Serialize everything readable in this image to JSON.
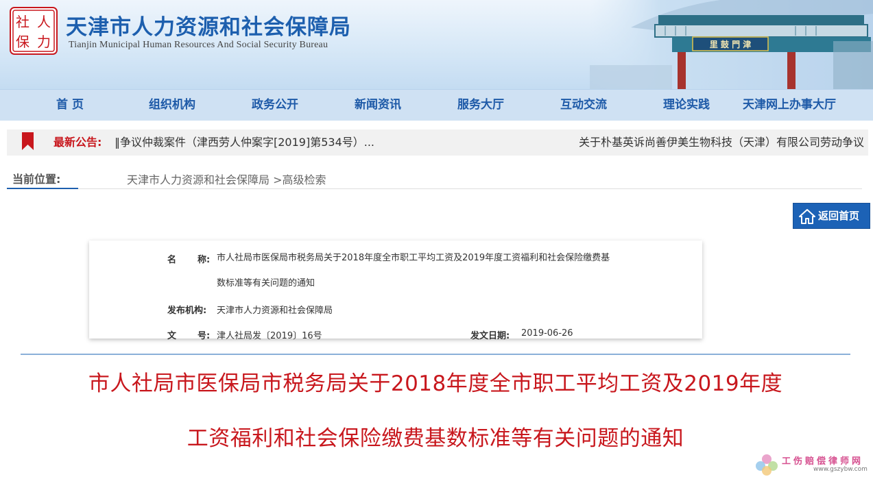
{
  "header": {
    "logo_chars": "社人保力",
    "title": "天津市人力资源和社会保障局",
    "subtitle": "Tianjin Municipal Human Resources And Social Security Bureau",
    "gate_sign": "里鼓门津"
  },
  "nav": {
    "items": [
      {
        "label": "首 页"
      },
      {
        "label": "组织机构"
      },
      {
        "label": "政务公开"
      },
      {
        "label": "新闻资讯"
      },
      {
        "label": "服务大厅"
      },
      {
        "label": "互动交流"
      },
      {
        "label": "理论实践"
      },
      {
        "label": "天津网上办事大厅"
      }
    ]
  },
  "notice": {
    "label": "最新公告:",
    "text1": "‖争议仲裁案件（津西劳人仲案字[2019]第534号）...",
    "text2": "关于朴基英诉尚善伊美生物科技（天津）有限公司劳动争议"
  },
  "breadcrumb": {
    "label": "当前位置:",
    "home": "天津市人力资源和社会保障局",
    "current": ">高级检索"
  },
  "back_button": {
    "label": "返回首页"
  },
  "info": {
    "name_key_1": "名",
    "name_key_2": "称:",
    "name_value": "市人社局市医保局市税务局关于2018年度全市职工平均工资及2019年度工资福利和社会保险缴费基数标准等有关问题的通知",
    "org_key": "发布机构:",
    "org_value": "天津市人力资源和社会保障局",
    "doc_key_1": "文",
    "doc_key_2": "号:",
    "doc_value": "津人社局发〔2019〕16号",
    "date_key": "发文日期:",
    "date_value": "2019-06-26"
  },
  "document": {
    "title_line1": "市人社局市医保局市税务局关于2018年度全市职工平均工资及2019年度",
    "title_line2": "工资福利和社会保险缴费基数标准等有关问题的通知"
  },
  "watermark": {
    "text": "工伤赔偿律师网",
    "url": "www.gszybw.com"
  },
  "colors": {
    "brand_blue": "#1d5fae",
    "nav_bg": "#cfe1f3",
    "title_red": "#c8171d"
  }
}
